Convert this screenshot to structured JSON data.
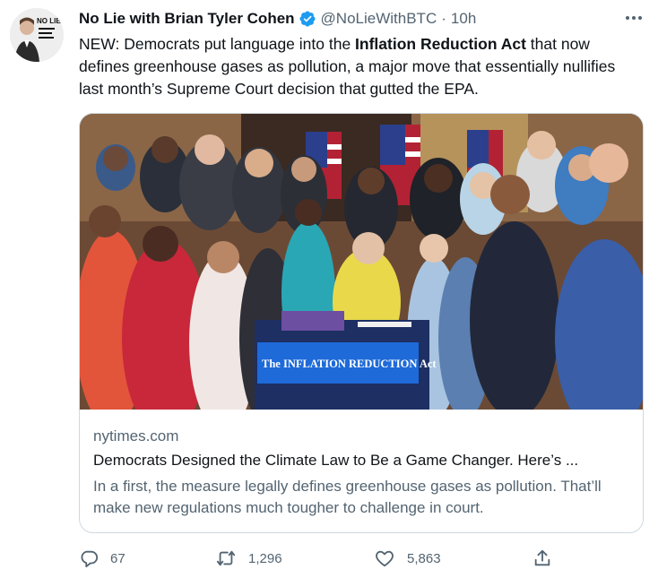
{
  "author": {
    "name": "No Lie with Brian Tyler Cohen",
    "handle": "@NoLieWithBTC",
    "separator": "·",
    "time": "10h",
    "verified": true,
    "avatar_logo_text": "NO LIE"
  },
  "tweet": {
    "text_before": "NEW: Democrats put language into the ",
    "text_bold": "Inflation Reduction Act",
    "text_after": " that now defines greenhouse gases as pollution, a major move that essentially nullifies last month’s Supreme Court decision that gutted the EPA."
  },
  "card": {
    "image_sign_text": "The INFLATION REDUCTION Act",
    "domain": "nytimes.com",
    "title": "Democrats Designed the Climate Law to Be a Game Changer. Here’s ...",
    "description": "In a first, the measure legally defines greenhouse gases as pollution. That’ll make new regulations much tougher to challenge in court."
  },
  "actions": {
    "replies": "67",
    "retweets": "1,296",
    "likes": "5,863"
  },
  "colors": {
    "text": "#0f1419",
    "secondary": "#536471",
    "verified_blue": "#1d9bf0",
    "border": "#cfd9de"
  },
  "icons": [
    "verified-badge-icon",
    "more-options-icon",
    "reply-icon",
    "retweet-icon",
    "like-icon",
    "share-icon"
  ]
}
